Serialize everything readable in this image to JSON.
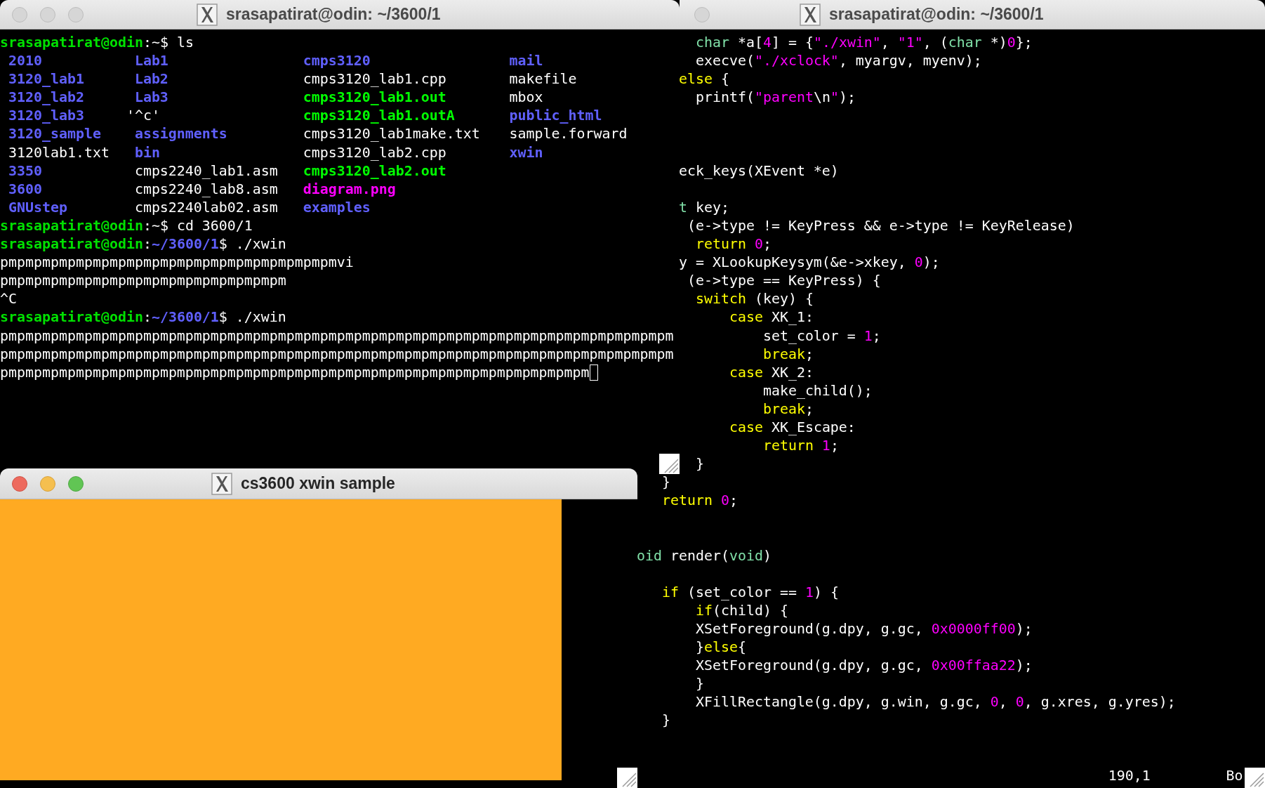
{
  "windows": [
    {
      "kind": "terminal",
      "title": "srasapatirat@odin: ~/3600/1",
      "active": false,
      "lines": [
        {
          "kind": "text",
          "segments": [
            {
              "text": "srasapatirat@odin",
              "kind": "host"
            },
            {
              "text": ":~$ ls",
              "kind": "plain"
            }
          ]
        },
        {
          "kind": "ls",
          "entries": [
            {
              "text": "2010",
              "kind": "dir"
            },
            {
              "text": "Lab1",
              "kind": "dir"
            },
            {
              "text": "cmps3120",
              "kind": "dir"
            },
            {
              "text": "mail",
              "kind": "dir"
            }
          ]
        },
        {
          "kind": "ls",
          "entries": [
            {
              "text": "3120_lab1",
              "kind": "dir"
            },
            {
              "text": "Lab2",
              "kind": "dir"
            },
            {
              "text": "cmps3120_lab1.cpp",
              "kind": "file"
            },
            {
              "text": "makefile",
              "kind": "file"
            }
          ]
        },
        {
          "kind": "ls",
          "entries": [
            {
              "text": "3120_lab2",
              "kind": "dir"
            },
            {
              "text": "Lab3",
              "kind": "dir"
            },
            {
              "text": "cmps3120_lab1.out",
              "kind": "exec"
            },
            {
              "text": "mbox",
              "kind": "file"
            }
          ]
        },
        {
          "kind": "ls",
          "entries": [
            {
              "text": "3120_lab3",
              "kind": "dir"
            },
            {
              "text": "'^c'",
              "kind": "quoted"
            },
            {
              "text": "cmps3120_lab1.outA",
              "kind": "exec"
            },
            {
              "text": "public_html",
              "kind": "dir"
            }
          ]
        },
        {
          "kind": "ls",
          "entries": [
            {
              "text": "3120_sample",
              "kind": "dir"
            },
            {
              "text": "assignments",
              "kind": "dir"
            },
            {
              "text": "cmps3120_lab1make.txt",
              "kind": "file"
            },
            {
              "text": "sample.forward",
              "kind": "file"
            }
          ]
        },
        {
          "kind": "ls",
          "entries": [
            {
              "text": "3120lab1.txt",
              "kind": "file"
            },
            {
              "text": "bin",
              "kind": "dir"
            },
            {
              "text": "cmps3120_lab2.cpp",
              "kind": "file"
            },
            {
              "text": "xwin",
              "kind": "dir"
            }
          ]
        },
        {
          "kind": "ls",
          "entries": [
            {
              "text": "3350",
              "kind": "dir"
            },
            {
              "text": "cmps2240_lab1.asm",
              "kind": "file"
            },
            {
              "text": "cmps3120_lab2.out",
              "kind": "exec"
            }
          ]
        },
        {
          "kind": "ls",
          "entries": [
            {
              "text": "3600",
              "kind": "dir"
            },
            {
              "text": "cmps2240_lab8.asm",
              "kind": "file"
            },
            {
              "text": "diagram.png",
              "kind": "image"
            }
          ]
        },
        {
          "kind": "ls",
          "entries": [
            {
              "text": "GNUstep",
              "kind": "dir"
            },
            {
              "text": "cmps2240lab02.asm",
              "kind": "file"
            },
            {
              "text": "examples",
              "kind": "dir"
            }
          ]
        },
        {
          "kind": "text",
          "segments": [
            {
              "text": "srasapatirat@odin",
              "kind": "host"
            },
            {
              "text": ":~$ cd 3600/1",
              "kind": "plain"
            }
          ]
        },
        {
          "kind": "text",
          "segments": [
            {
              "text": "srasapatirat@odin",
              "kind": "host"
            },
            {
              "text": ":",
              "kind": "plain"
            },
            {
              "text": "~/3600/1",
              "kind": "path"
            },
            {
              "text": "$ ./xwin",
              "kind": "plain"
            }
          ]
        },
        {
          "kind": "text",
          "segments": [
            {
              "text": "pmpmpmpmpmpmpmpmpmpmpmpmpmpmpmpmpmpmpmpmvi",
              "kind": "plain"
            }
          ]
        },
        {
          "kind": "text",
          "segments": [
            {
              "text": "pmpmpmpmpmpmpmpmpmpmpmpmpmpmpmpmpm",
              "kind": "plain"
            }
          ]
        },
        {
          "kind": "text",
          "segments": [
            {
              "text": "^C",
              "kind": "plain"
            }
          ]
        },
        {
          "kind": "text",
          "segments": [
            {
              "text": "srasapatirat@odin",
              "kind": "host"
            },
            {
              "text": ":",
              "kind": "plain"
            },
            {
              "text": "~/3600/1",
              "kind": "path"
            },
            {
              "text": "$ ./xwin",
              "kind": "plain"
            }
          ]
        },
        {
          "kind": "text",
          "segments": [
            {
              "text": "pmpmpmpmpmpmpmpmpmpmpmpmpmpmpmpmpmpmpmpmpmpmpmpmpmpmpmpmpmpmpmpmpmpmpmpmpmpmpmpm",
              "kind": "plain"
            }
          ]
        },
        {
          "kind": "text",
          "segments": [
            {
              "text": "pmpmpmpmpmpmpmpmpmpmpmpmpmpmpmpmpmpmpmpmpmpmpmpmpmpmpmpmpmpmpmpmpmpmpmpmpmpmpmpm",
              "kind": "plain"
            }
          ]
        },
        {
          "kind": "text",
          "cursor": true,
          "segments": [
            {
              "text": "pmpmpmpmpmpmpmpmpmpmpmpmpmpmpmpmpmpmpmpmpmpmpmpmpmpmpmpmpmpmpmpmpmpmpm",
              "kind": "plain"
            }
          ]
        }
      ]
    },
    {
      "kind": "terminal",
      "title": "srasapatirat@odin: ~/3600/1",
      "active": false,
      "lines": [
        {
          "kind": "text",
          "segments": [
            {
              "text": "        char",
              "kind": "type"
            },
            {
              "text": " *a[",
              "kind": "plain"
            },
            {
              "text": "4",
              "kind": "number"
            },
            {
              "text": "] = {",
              "kind": "plain"
            },
            {
              "text": "\"./xwin\"",
              "kind": "string"
            },
            {
              "text": ", ",
              "kind": "plain"
            },
            {
              "text": "\"1\"",
              "kind": "string"
            },
            {
              "text": ", (",
              "kind": "plain"
            },
            {
              "text": "char",
              "kind": "type"
            },
            {
              "text": " *)",
              "kind": "plain"
            },
            {
              "text": "0",
              "kind": "number"
            },
            {
              "text": "};",
              "kind": "plain"
            }
          ]
        },
        {
          "kind": "text",
          "segments": [
            {
              "text": "        execve(",
              "kind": "plain"
            },
            {
              "text": "\"./xclock\"",
              "kind": "string"
            },
            {
              "text": ", myargv, myenv);",
              "kind": "plain"
            }
          ]
        },
        {
          "kind": "text",
          "segments": [
            {
              "text": "      else",
              "kind": "keyword"
            },
            {
              "text": " {",
              "kind": "plain"
            }
          ]
        },
        {
          "kind": "text",
          "segments": [
            {
              "text": "        printf(",
              "kind": "plain"
            },
            {
              "text": "\"parent",
              "kind": "string"
            },
            {
              "text": "\\n",
              "kind": "plain"
            },
            {
              "text": "\"",
              "kind": "string"
            },
            {
              "text": ");",
              "kind": "plain"
            }
          ]
        },
        {
          "kind": "blank"
        },
        {
          "kind": "blank"
        },
        {
          "kind": "blank"
        },
        {
          "kind": "text",
          "segments": [
            {
              "text": "      eck_keys(XEvent *e)",
              "kind": "plain"
            }
          ]
        },
        {
          "kind": "blank"
        },
        {
          "kind": "text",
          "segments": [
            {
              "text": "      t",
              "kind": "type"
            },
            {
              "text": " key;",
              "kind": "plain"
            }
          ]
        },
        {
          "kind": "text",
          "segments": [
            {
              "text": "       (e->type != KeyPress && e->type != KeyRelease)",
              "kind": "plain"
            }
          ]
        },
        {
          "kind": "text",
          "segments": [
            {
              "text": "        return",
              "kind": "keyword"
            },
            {
              "text": " 0",
              "kind": "number"
            },
            {
              "text": ";",
              "kind": "plain"
            }
          ]
        },
        {
          "kind": "text",
          "segments": [
            {
              "text": "      y = XLookupKeysym(&e->xkey, ",
              "kind": "plain"
            },
            {
              "text": "0",
              "kind": "number"
            },
            {
              "text": ");",
              "kind": "plain"
            }
          ]
        },
        {
          "kind": "text",
          "segments": [
            {
              "text": "       (e->type == KeyPress) {",
              "kind": "plain"
            }
          ]
        },
        {
          "kind": "text",
          "segments": [
            {
              "text": "        switch",
              "kind": "keyword"
            },
            {
              "text": " (key) {",
              "kind": "plain"
            }
          ]
        },
        {
          "kind": "text",
          "segments": [
            {
              "text": "            case",
              "kind": "keyword"
            },
            {
              "text": " XK_1:",
              "kind": "plain"
            }
          ]
        },
        {
          "kind": "text",
          "segments": [
            {
              "text": "                set_color = ",
              "kind": "plain"
            },
            {
              "text": "1",
              "kind": "number"
            },
            {
              "text": ";",
              "kind": "plain"
            }
          ]
        },
        {
          "kind": "text",
          "segments": [
            {
              "text": "                break",
              "kind": "keyword"
            },
            {
              "text": ";",
              "kind": "plain"
            }
          ]
        },
        {
          "kind": "text",
          "segments": [
            {
              "text": "            case",
              "kind": "keyword"
            },
            {
              "text": " XK_2:",
              "kind": "plain"
            }
          ]
        },
        {
          "kind": "text",
          "segments": [
            {
              "text": "                make_child();",
              "kind": "plain"
            }
          ]
        },
        {
          "kind": "text",
          "segments": [
            {
              "text": "                break",
              "kind": "keyword"
            },
            {
              "text": ";",
              "kind": "plain"
            }
          ]
        },
        {
          "kind": "text",
          "segments": [
            {
              "text": "            case",
              "kind": "keyword"
            },
            {
              "text": " XK_Escape:",
              "kind": "plain"
            }
          ]
        },
        {
          "kind": "text",
          "segments": [
            {
              "text": "                return",
              "kind": "keyword"
            },
            {
              "text": " 1",
              "kind": "number"
            },
            {
              "text": ";",
              "kind": "plain"
            }
          ]
        },
        {
          "kind": "text",
          "segments": [
            {
              "text": "        }",
              "kind": "plain"
            }
          ]
        },
        {
          "kind": "text",
          "segments": [
            {
              "text": "    }",
              "kind": "plain"
            }
          ]
        },
        {
          "kind": "text",
          "segments": [
            {
              "text": "    return",
              "kind": "keyword"
            },
            {
              "text": " 0",
              "kind": "number"
            },
            {
              "text": ";",
              "kind": "plain"
            }
          ]
        },
        {
          "kind": "blank"
        },
        {
          "kind": "blank"
        },
        {
          "kind": "text",
          "segments": [
            {
              "text": " oid",
              "kind": "type"
            },
            {
              "text": " render(",
              "kind": "plain"
            },
            {
              "text": "void",
              "kind": "type"
            },
            {
              "text": ")",
              "kind": "plain"
            }
          ]
        },
        {
          "kind": "blank"
        },
        {
          "kind": "text",
          "segments": [
            {
              "text": "    if",
              "kind": "keyword"
            },
            {
              "text": " (set_color == ",
              "kind": "plain"
            },
            {
              "text": "1",
              "kind": "number"
            },
            {
              "text": ") {",
              "kind": "plain"
            }
          ]
        },
        {
          "kind": "text",
          "segments": [
            {
              "text": "        if",
              "kind": "keyword"
            },
            {
              "text": "(child) {",
              "kind": "plain"
            }
          ]
        },
        {
          "kind": "text",
          "segments": [
            {
              "text": "        XSetForeground(g.dpy, g.gc, ",
              "kind": "plain"
            },
            {
              "text": "0x0000ff00",
              "kind": "number"
            },
            {
              "text": ");",
              "kind": "plain"
            }
          ]
        },
        {
          "kind": "text",
          "segments": [
            {
              "text": "        }",
              "kind": "plain"
            },
            {
              "text": "else",
              "kind": "keyword"
            },
            {
              "text": "{",
              "kind": "plain"
            }
          ]
        },
        {
          "kind": "text",
          "segments": [
            {
              "text": "        XSetForeground(g.dpy, g.gc, ",
              "kind": "plain"
            },
            {
              "text": "0x00ffaa22",
              "kind": "number"
            },
            {
              "text": ");",
              "kind": "plain"
            }
          ]
        },
        {
          "kind": "text",
          "segments": [
            {
              "text": "        }",
              "kind": "plain"
            }
          ]
        },
        {
          "kind": "text",
          "segments": [
            {
              "text": "        XFillRectangle(g.dpy, g.win, g.gc, ",
              "kind": "plain"
            },
            {
              "text": "0",
              "kind": "number"
            },
            {
              "text": ", ",
              "kind": "plain"
            },
            {
              "text": "0",
              "kind": "number"
            },
            {
              "text": ", g.xres, g.yres);",
              "kind": "plain"
            }
          ]
        },
        {
          "kind": "text",
          "segments": [
            {
              "text": "    }",
              "kind": "plain"
            }
          ]
        },
        {
          "kind": "blank"
        },
        {
          "kind": "blank"
        },
        {
          "kind": "status",
          "segments": [
            {
              "text": "                                                         190,1",
              "kind": "plain"
            },
            {
              "text": "         Bo",
              "kind": "plain"
            }
          ]
        }
      ]
    },
    {
      "kind": "xwindow",
      "title": "cs3600 xwin sample",
      "active": true
    }
  ]
}
